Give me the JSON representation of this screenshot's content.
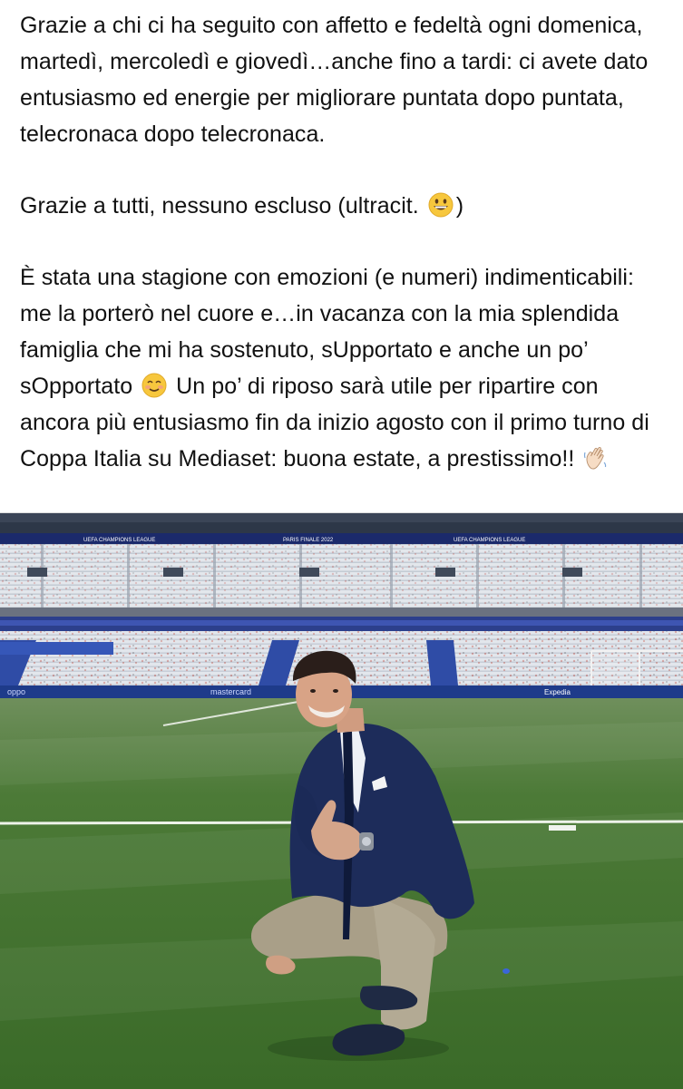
{
  "post": {
    "paragraphs": [
      {
        "segments": [
          {
            "type": "text",
            "value": "Grazie a chi ci ha seguito con affetto e fedeltà ogni domenica, martedì, mercoledì e giovedì…anche fino a tardi: ci avete dato entusiasmo ed energie per migliorare puntata dopo puntata, telecronaca dopo telecronaca."
          }
        ]
      },
      {
        "segments": [
          {
            "type": "text",
            "value": "Grazie a tutti, nessuno escluso (ultracit. "
          },
          {
            "type": "emoji",
            "icon": "grinning-face-emoji"
          },
          {
            "type": "text",
            "value": ")"
          }
        ]
      },
      {
        "segments": [
          {
            "type": "text",
            "value": "È stata una stagione con emozioni (e numeri) indimenticabili: me la porterò nel cuore e…in vacanza con la mia splendida famiglia che mi ha sostenuto, sUpportato e anche un po’ sOpportato "
          },
          {
            "type": "emoji",
            "icon": "smiling-face-emoji"
          },
          {
            "type": "text",
            "value": " Un po’ di riposo sarà utile per ripartire con ancora più entusiasmo fin da inizio agosto con il primo turno di Coppa Italia su Mediaset: buona estate, a prestissimo!! "
          },
          {
            "type": "emoji",
            "icon": "waving-hand-emoji"
          }
        ]
      }
    ]
  },
  "photo": {
    "banner_text_1": "UEFA CHAMPIONS LEAGUE",
    "banner_text_2": "PARIS FINALE 2022",
    "banner_text_3": "UEFA CHAMPIONS LEAGUE",
    "board_text_left": "oppo",
    "board_text_mid": "mastercard",
    "board_text_right": "Expedia",
    "colors": {
      "pitch": "#3d6f2c",
      "pitch_light": "#4d8038",
      "seats": "#dfe3ea",
      "roof_band": "#1b2a6b",
      "jacket": "#1c2b57",
      "trousers": "#a89e88"
    }
  }
}
